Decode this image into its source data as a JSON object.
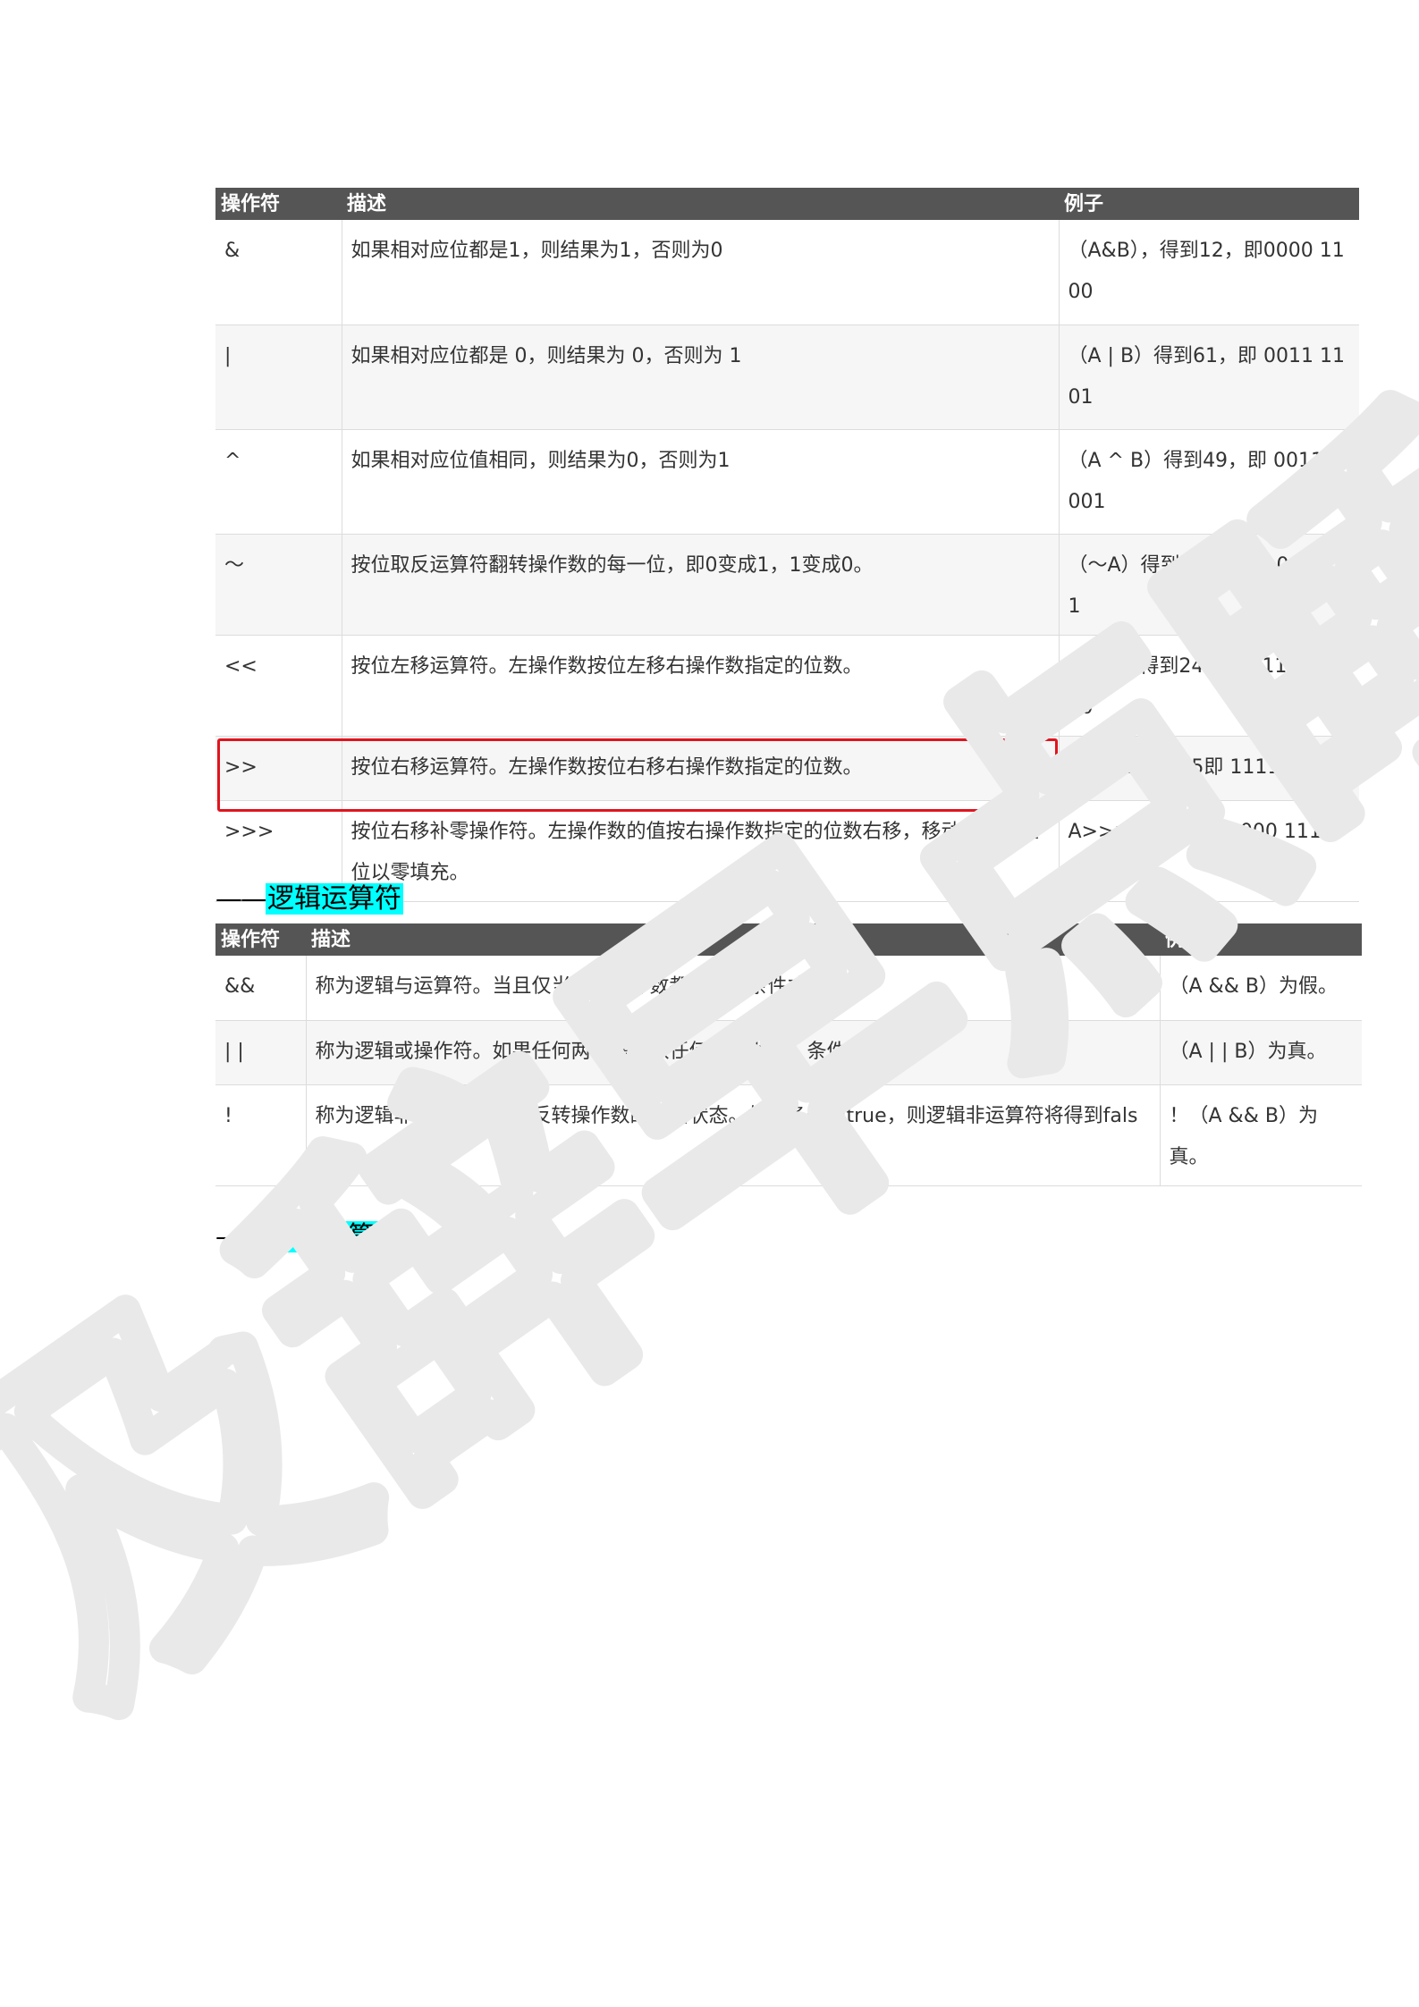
{
  "bitwise_table": {
    "headers": [
      "操作符",
      "描述",
      "例子"
    ],
    "rows": [
      {
        "op": "&",
        "desc": "如果相对应位都是1，则结果为1，否则为0",
        "example": "（A&B），得到12，即0000 1100"
      },
      {
        "op": "|",
        "desc": "如果相对应位都是 0，则结果为 0，否则为 1",
        "example": "（A | B）得到61，即 0011 1101"
      },
      {
        "op": "^",
        "desc": "如果相对应位值相同，则结果为0，否则为1",
        "example": "（A ^ B）得到49，即 0011 0001"
      },
      {
        "op": "〜",
        "desc": "按位取反运算符翻转操作数的每一位，即0变成1，1变成0。",
        "example": "（〜A）得到-61，即1100 0011"
      },
      {
        "op": "<<",
        "desc": "按位左移运算符。左操作数按位左移右操作数指定的位数。",
        "example": "A << 2得到240，即 1111 0000"
      },
      {
        "op": ">>",
        "desc": "按位右移运算符。左操作数按位右移右操作数指定的位数。",
        "example": "A >> 2得到15即 1111"
      },
      {
        "op": ">>>",
        "desc": "按位右移补零操作符。左操作数的值按右操作数指定的位数右移，移动得到的空位以零填充。",
        "example": "A>>>2得到15即0000 1111"
      }
    ]
  },
  "logical_section": {
    "prefix": "——",
    "title": "逻辑运算符"
  },
  "logical_table": {
    "headers": [
      "操作符",
      "描述",
      "例子"
    ],
    "rows": [
      {
        "op": "&&",
        "desc": "称为逻辑与运算符。当且仅当两个操作数都为真，条件才为真。",
        "example": "（A && B）为假。"
      },
      {
        "op": "| |",
        "desc": "称为逻辑或操作符。如果任何两个操作数任何一个为真，条件为真。",
        "example": "（A | | B）为真。"
      },
      {
        "op": "!",
        "desc": "称为逻辑非运算符。用来反转操作数的逻辑状态。如果条件为true，则逻辑非运算符将得到false。",
        "example": "！（A && B）为真。"
      }
    ]
  },
  "assignment_section": {
    "prefix": "——",
    "title": "赋值运算符"
  },
  "watermark": {
    "text": "及辞早点睡",
    "color": "#e9e9e9"
  },
  "colors": {
    "header_bg": "#555555",
    "alt_row_bg": "#f6f6f6",
    "highlight_box": "#e0141e",
    "heading_highlight": "#00ffff"
  }
}
